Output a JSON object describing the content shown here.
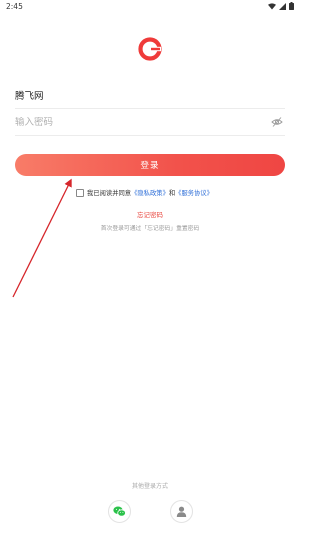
{
  "status_bar": {
    "time": "2:45"
  },
  "form": {
    "username_value": "腾飞网",
    "password_placeholder": "输入密码"
  },
  "login_button": {
    "label": "登录"
  },
  "agreement": {
    "prefix": "我已阅读并同意",
    "privacy_link": "《隐私政策》",
    "and": "和",
    "service_link": "《服务协议》"
  },
  "forgot_password": "忘记密码",
  "hint": "首次登录可通过「忘记密码」重置密码",
  "other_login": {
    "title": "其他登录方式",
    "options": [
      "wechat-icon",
      "user-icon"
    ]
  },
  "colors": {
    "accent": "#ef4643",
    "link": "#2f6fd8",
    "annotation_arrow": "#d6262b"
  }
}
